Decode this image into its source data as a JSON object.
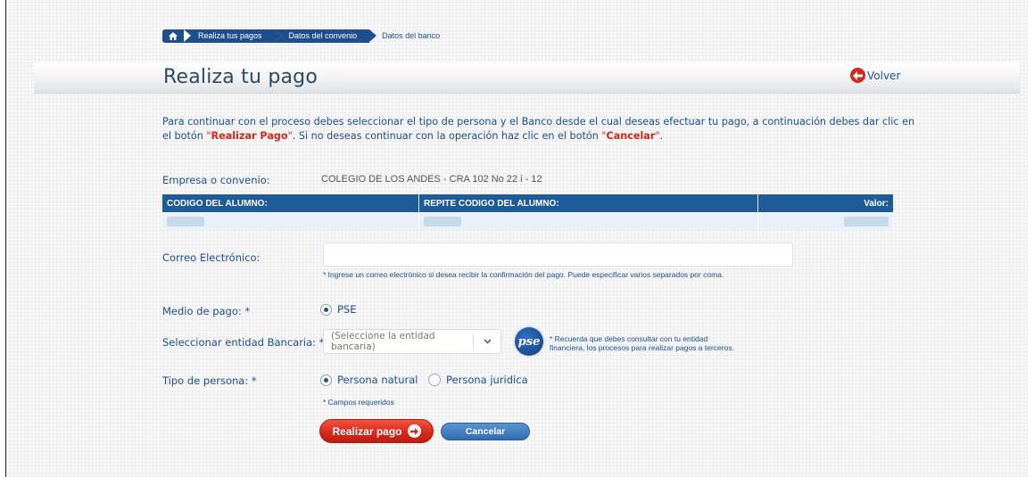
{
  "breadcrumb": {
    "items": [
      "Realiza tus pagos",
      "Datos del convenio"
    ],
    "current": "Datos del banco"
  },
  "header": {
    "title": "Realiza tu pago",
    "back_label": "Volver"
  },
  "intro": {
    "part1": "Para continuar con el proceso debes seleccionar el tipo de persona y el Banco desde el cual deseas efectuar tu pago, a continuación debes dar clic en el botón ",
    "quote_open": "\"",
    "realizar": "Realizar Pago",
    "quote_close": "\"",
    "part2": ". Si no deseas continuar con la operación haz clic en el botón ",
    "cancelar": "Cancelar",
    "part3": "."
  },
  "company": {
    "label": "Empresa o convenio:",
    "value": "COLEGIO DE LOS ANDES - CRA 102 No 22 i - 12"
  },
  "table": {
    "headers": [
      "CODIGO DEL ALUMNO:",
      "REPITE CODIGO DEL ALUMNO:",
      "Valor:"
    ]
  },
  "email": {
    "label": "Correo Electrónico:",
    "value": "",
    "hint": "* Ingrese un correo electrónico si desea recibir la confirmación del pago. Puede especificar varios separados por coma."
  },
  "payment_method": {
    "label": "Medio de pago: *",
    "option": "PSE"
  },
  "bank": {
    "label": "Seleccionar entidad Bancaria: *",
    "selected": "(Seleccione la entidad bancaria)",
    "logo_text": "pse",
    "note_line1": "* Recuerda que debes consultar con tu entidad",
    "note_line2": "financiera,   los procesos para realizar pagos a terceros."
  },
  "person_type": {
    "label": "Tipo de persona: *",
    "options": [
      "Persona natural",
      "Persona juridica"
    ],
    "selected": "Persona natural"
  },
  "required_note": "* Campos requeridos",
  "buttons": {
    "pay": "Realizar pago",
    "cancel": "Cancelar"
  },
  "colors": {
    "primary": "#1e4e8c",
    "accent_red": "#d9261c",
    "table_header": "#1e5b99"
  }
}
